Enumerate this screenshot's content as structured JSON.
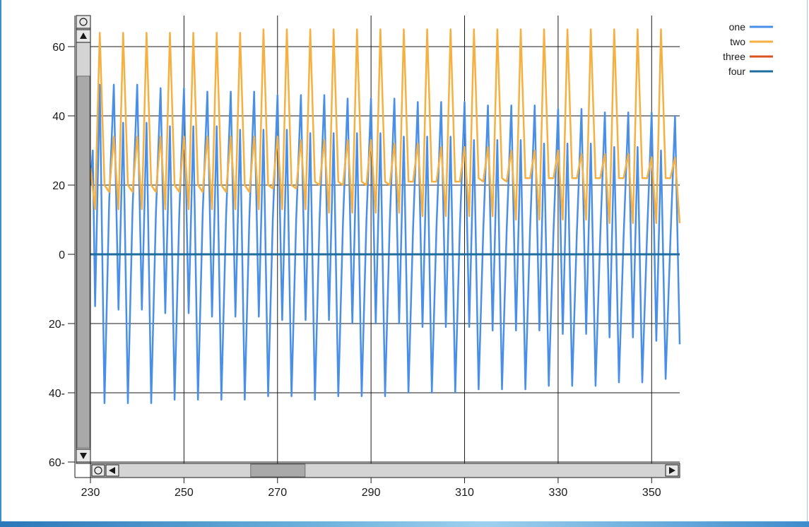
{
  "chart_data": {
    "type": "line",
    "xlim": [
      230,
      356
    ],
    "ylim": [
      -60,
      60
    ],
    "x_ticks": [
      230,
      250,
      270,
      290,
      310,
      330,
      350
    ],
    "x_tick_labels": [
      "230",
      "250",
      "270",
      "290",
      "310",
      "330",
      "350"
    ],
    "y_ticks": [
      60,
      40,
      20,
      0,
      -20,
      -40,
      -60
    ],
    "y_tick_labels": [
      "60",
      "40",
      "20",
      "0",
      "20-",
      "40-",
      "60-"
    ],
    "grid": true,
    "legend_position": "top-right",
    "series": [
      {
        "name": "one",
        "color": "#4a8fe7",
        "x": [
          230,
          230.5,
          231,
          232,
          233,
          234,
          235,
          236,
          237,
          238,
          239,
          240,
          241,
          242,
          243,
          244,
          245,
          246,
          247,
          248,
          249,
          250,
          251,
          252,
          253,
          254,
          255,
          256,
          257,
          258,
          259,
          260,
          261,
          262,
          263,
          264,
          265,
          266,
          267,
          268,
          269,
          270,
          271,
          272,
          273,
          274,
          275,
          276,
          277,
          278,
          279,
          280,
          281,
          282,
          283,
          284,
          285,
          286,
          287,
          288,
          289,
          290,
          291,
          292,
          293,
          294,
          295,
          296,
          297,
          298,
          299,
          300,
          301,
          302,
          303,
          304,
          305,
          306,
          307,
          308,
          309,
          310,
          311,
          312,
          313,
          314,
          315,
          316,
          317,
          318,
          319,
          320,
          321,
          322,
          323,
          324,
          325,
          326,
          327,
          328,
          329,
          330,
          331,
          332,
          333,
          334,
          335,
          336,
          337,
          338,
          339,
          340,
          341,
          342,
          343,
          344,
          345,
          346,
          347,
          348,
          349,
          350,
          351,
          352,
          353,
          354,
          355,
          356
        ],
        "values": [
          20,
          30,
          -15,
          49,
          -43,
          15,
          49,
          -16,
          38,
          -43,
          13,
          49,
          -16,
          38,
          -43,
          12,
          48,
          -17,
          37,
          -42,
          12,
          48,
          -17,
          37,
          -42,
          12,
          47,
          -18,
          37,
          -42,
          11,
          47,
          -18,
          36,
          -42,
          11,
          47,
          -18,
          36,
          -41,
          10,
          46,
          -19,
          36,
          -41,
          10,
          46,
          -19,
          35,
          -42,
          10,
          46,
          -19,
          35,
          -41,
          9,
          45,
          -20,
          35,
          -41,
          9,
          45,
          -20,
          35,
          -41,
          9,
          45,
          -20,
          34,
          -40,
          8,
          44,
          -21,
          34,
          -40,
          8,
          44,
          -21,
          34,
          -40,
          8,
          44,
          -21,
          33,
          -39,
          7,
          43,
          -22,
          33,
          -39,
          7,
          43,
          -22,
          33,
          -39,
          7,
          43,
          -22,
          32,
          -38,
          6,
          42,
          -23,
          32,
          -38,
          6,
          42,
          -23,
          32,
          -38,
          5,
          41,
          -24,
          31,
          -37,
          5,
          41,
          -24,
          31,
          -37,
          5,
          41,
          -25,
          30,
          -36,
          4,
          40,
          -26
        ]
      },
      {
        "name": "two",
        "color": "#f5b041",
        "x": [
          230,
          231,
          232,
          233,
          234,
          235,
          236,
          237,
          238,
          239,
          240,
          241,
          242,
          243,
          244,
          245,
          246,
          247,
          248,
          249,
          250,
          251,
          252,
          253,
          254,
          255,
          256,
          257,
          258,
          259,
          260,
          261,
          262,
          263,
          264,
          265,
          266,
          267,
          268,
          269,
          270,
          271,
          272,
          273,
          274,
          275,
          276,
          277,
          278,
          279,
          280,
          281,
          282,
          283,
          284,
          285,
          286,
          287,
          288,
          289,
          290,
          291,
          292,
          293,
          294,
          295,
          296,
          297,
          298,
          299,
          300,
          301,
          302,
          303,
          304,
          305,
          306,
          307,
          308,
          309,
          310,
          311,
          312,
          313,
          314,
          315,
          316,
          317,
          318,
          319,
          320,
          321,
          322,
          323,
          324,
          325,
          326,
          327,
          328,
          329,
          330,
          331,
          332,
          333,
          334,
          335,
          336,
          337,
          338,
          339,
          340,
          341,
          342,
          343,
          344,
          345,
          346,
          347,
          348,
          349,
          350,
          351,
          352,
          353,
          354,
          355,
          356
        ],
        "values": [
          25,
          13,
          64,
          20,
          18,
          34,
          13,
          64,
          20,
          18,
          34,
          13,
          64,
          20,
          18,
          34,
          13,
          64,
          20,
          18,
          34,
          13,
          64,
          20,
          18,
          34,
          13,
          64,
          20,
          18,
          34,
          13,
          64,
          20,
          18,
          34,
          13,
          65,
          20,
          19,
          34,
          13,
          65,
          20,
          19,
          33,
          13,
          65,
          21,
          20,
          33,
          12,
          65,
          21,
          20,
          33,
          12,
          65,
          21,
          20,
          33,
          12,
          65,
          21,
          20,
          32,
          12,
          65,
          21,
          21,
          32,
          11,
          65,
          21,
          21,
          31,
          11,
          65,
          21,
          21,
          31,
          11,
          65,
          22,
          21,
          31,
          11,
          65,
          22,
          21,
          30,
          10,
          65,
          22,
          22,
          30,
          10,
          65,
          22,
          22,
          30,
          10,
          65,
          22,
          22,
          29,
          10,
          65,
          22,
          22,
          29,
          9,
          65,
          22,
          22,
          29,
          9,
          65,
          22,
          22,
          28,
          9,
          65,
          22,
          22,
          28,
          9
        ]
      },
      {
        "name": "three",
        "color": "#d9531e",
        "x": [
          230,
          356
        ],
        "values": [
          0,
          0
        ]
      },
      {
        "name": "four",
        "color": "#1f6c9e",
        "x": [
          230,
          356
        ],
        "values": [
          0,
          0
        ]
      }
    ]
  },
  "legend": {
    "items": [
      "one",
      "two",
      "three",
      "four"
    ],
    "colors": [
      "#4a8fe7",
      "#f5b041",
      "#d9531e",
      "#1f6c9e"
    ]
  },
  "vertical_scrollbar": {
    "thumb_fraction_start": 0.08,
    "thumb_fraction_end": 1.0
  },
  "horizontal_scrollbar": {
    "thumb_fraction_start": 0.24,
    "thumb_fraction_end": 0.34
  }
}
